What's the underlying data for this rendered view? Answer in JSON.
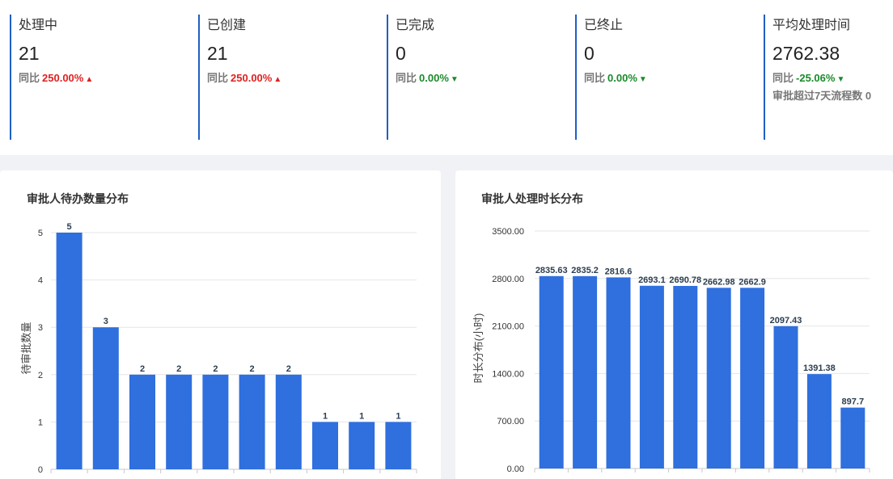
{
  "stats": [
    {
      "title": "处理中",
      "value": "21",
      "compare_label": "同比",
      "compare_pct": "250.00%",
      "direction": "up"
    },
    {
      "title": "已创建",
      "value": "21",
      "compare_label": "同比",
      "compare_pct": "250.00%",
      "direction": "up"
    },
    {
      "title": "已完成",
      "value": "0",
      "compare_label": "同比",
      "compare_pct": "0.00%",
      "direction": "down"
    },
    {
      "title": "已终止",
      "value": "0",
      "compare_label": "同比",
      "compare_pct": "0.00%",
      "direction": "down"
    },
    {
      "title": "平均处理时间",
      "value": "2762.38",
      "compare_label": "同比",
      "compare_pct": "-25.06%",
      "direction": "down",
      "extra": "审批超过7天流程数 0"
    }
  ],
  "arrows": {
    "up": "▲",
    "down": "▼"
  },
  "colors": {
    "accent": "#1f5fc4",
    "bar": "#2f6fde",
    "up": "#e02020",
    "down": "#1a8a2a"
  },
  "chart_data": [
    {
      "type": "bar",
      "title": "审批人待办数量分布",
      "ylabel": "待审批数量",
      "xlabel": "",
      "ylim": [
        0,
        5
      ],
      "yticks": [
        "0",
        "1",
        "2",
        "3",
        "4",
        "5"
      ],
      "values": [
        5,
        3,
        2,
        2,
        2,
        2,
        2,
        1,
        1,
        1
      ],
      "labels": [
        "5",
        "3",
        "2",
        "2",
        "2",
        "2",
        "2",
        "1",
        "1",
        "1"
      ],
      "grid": true
    },
    {
      "type": "bar",
      "title": "审批人处理时长分布",
      "ylabel": "时长分布(小时)",
      "xlabel": "",
      "ylim": [
        0,
        3500
      ],
      "yticks": [
        "0.00",
        "700.00",
        "1400.00",
        "2100.00",
        "2800.00",
        "3500.00"
      ],
      "values": [
        2835.63,
        2835.2,
        2816.6,
        2693.1,
        2690.78,
        2662.98,
        2662.9,
        2097.43,
        1391.38,
        897.7
      ],
      "labels": [
        "2835.63",
        "2835.2",
        "2816.6",
        "2693.1",
        "2690.78",
        "2662.98",
        "2662.9",
        "2097.43",
        "1391.38",
        "897.7"
      ],
      "grid": true
    }
  ]
}
